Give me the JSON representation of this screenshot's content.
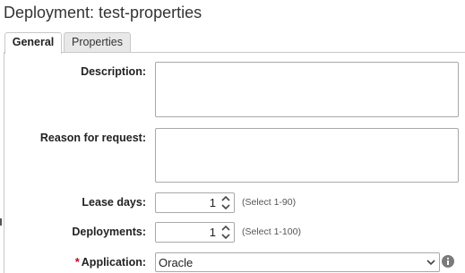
{
  "header": {
    "title": "Deployment: test-properties"
  },
  "tabs": [
    {
      "label": "General",
      "active": true
    },
    {
      "label": "Properties",
      "active": false
    }
  ],
  "form": {
    "description": {
      "label": "Description:",
      "value": ""
    },
    "reason": {
      "label": "Reason for request:",
      "value": ""
    },
    "lease_days": {
      "label": "Lease days:",
      "value": "1",
      "hint": "(Select 1-90)"
    },
    "deployments": {
      "label": "Deployments:",
      "value": "1",
      "hint": "(Select 1-100)"
    },
    "application": {
      "label": "Application:",
      "required_marker": "*",
      "value": "Oracle"
    }
  },
  "icons": {
    "stepper": "up-down-arrows-icon",
    "select": "chevron-down-icon",
    "info": "info-icon"
  },
  "colors": {
    "required": "#d0021b",
    "border": "#a9a9a9",
    "inactive_tab": "#e8e8e8"
  }
}
